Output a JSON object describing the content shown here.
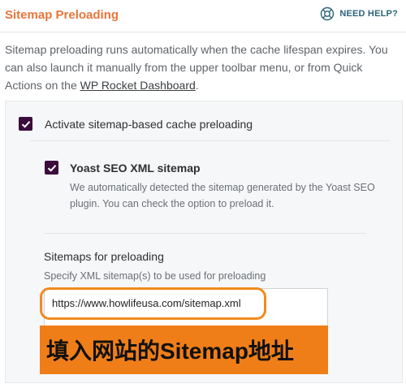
{
  "header": {
    "title": "Sitemap Preloading",
    "help_label": "NEED HELP?",
    "help_icon": "lifebuoy-icon"
  },
  "description": {
    "text_before": "Sitemap preloading runs automatically when the cache lifespan expires. You can also launch it manually from the upper toolbar menu, or from Quick Actions on the ",
    "link_text": "WP Rocket Dashboard",
    "text_after": "."
  },
  "options": {
    "main": {
      "label": "Activate sitemap-based cache preloading",
      "checked": true
    },
    "yoast": {
      "label": "Yoast SEO XML sitemap",
      "checked": true,
      "description": "We automatically detected the sitemap generated by the Yoast SEO plugin. You can check the option to preload it."
    }
  },
  "sitemaps": {
    "title": "Sitemaps for preloading",
    "description": "Specify XML sitemap(s) to be used for preloading",
    "value": "https://www.howlifeusa.com/sitemap.xml"
  },
  "annotation": {
    "banner_text": "填入网站的Sitemap地址",
    "highlight_color": "#f28a1f",
    "banner_color": "#f07e18"
  },
  "colors": {
    "title": "#e8753a",
    "checkbox": "#3b0d3c",
    "help": "#2a6478"
  }
}
